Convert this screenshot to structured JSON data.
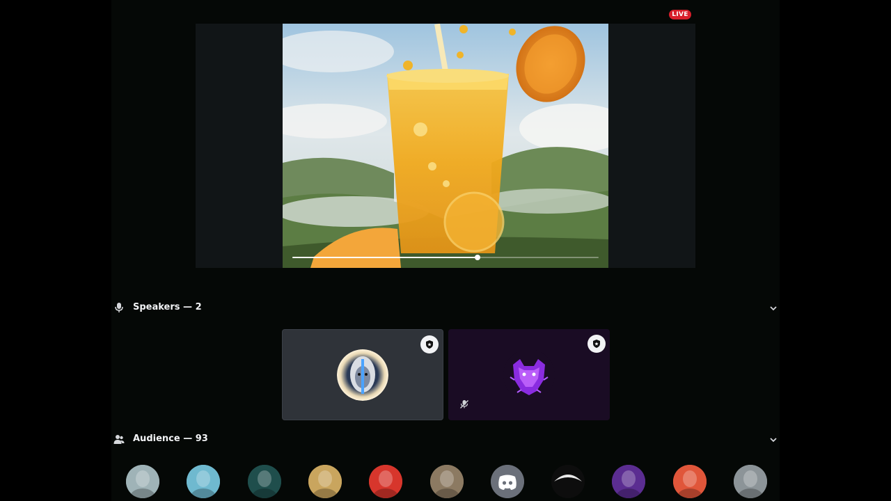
{
  "live_badge": "LIVE",
  "stream": {
    "progress": 0.605
  },
  "speakers": {
    "label": "Speakers — 2",
    "icon": "microphone-icon",
    "tiles": [
      {
        "avatar": "white-haired-figure-avatar",
        "badge_icon": "shield-star-icon",
        "muted": false
      },
      {
        "avatar": "purple-panther-avatar",
        "badge_icon": "shield-star-icon",
        "muted": true
      }
    ]
  },
  "audience": {
    "label": "Audience — 93",
    "icon": "people-icon",
    "avatars": [
      {
        "name": "audience-avatar-1",
        "color": "#9fb3b7"
      },
      {
        "name": "audience-avatar-2",
        "color": "#6fb9cf"
      },
      {
        "name": "audience-avatar-3",
        "color": "#1f4e4c"
      },
      {
        "name": "audience-avatar-4",
        "color": "#c9a55e"
      },
      {
        "name": "audience-avatar-5",
        "color": "#d7362c"
      },
      {
        "name": "audience-avatar-6",
        "color": "#8c7a62"
      },
      {
        "name": "audience-avatar-7",
        "color": "#6b707a"
      },
      {
        "name": "audience-avatar-8",
        "color": "#0d0d0d"
      },
      {
        "name": "audience-avatar-9",
        "color": "#5b2d91"
      },
      {
        "name": "audience-avatar-10",
        "color": "#e0563a"
      },
      {
        "name": "audience-avatar-11",
        "color": "#8c9498"
      }
    ]
  },
  "colors": {
    "live": "#d81e2b",
    "background": "#050806",
    "tile": "#2f3339",
    "tile_purple": "#1a0c24"
  }
}
